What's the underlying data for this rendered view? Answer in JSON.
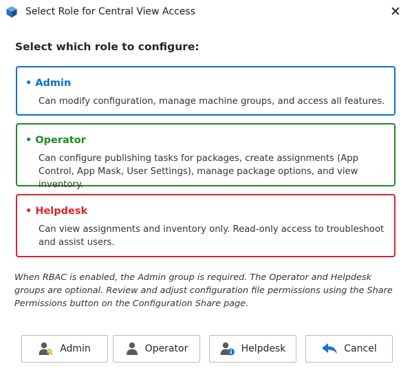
{
  "window": {
    "title": "Select Role for Central View Access",
    "close_label": "✕"
  },
  "heading": "Select which role to configure:",
  "roles": [
    {
      "title": "• Admin",
      "description": "Can modify configuration, manage machine groups, and access all features.",
      "color": "#0a6fd0"
    },
    {
      "title": "• Operator",
      "description": "Can configure publishing tasks for packages, create assignments (App Control, App Mask, User Settings), manage package options, and view inventory.",
      "color": "#1f8a1f"
    },
    {
      "title": "• Helpdesk",
      "description": "Can view assignments and inventory only. Read-only access to troubleshoot and assist users.",
      "color": "#d9232a"
    }
  ],
  "note": "When RBAC is enabled, the Admin group is required. The Operator and Helpdesk groups are optional. Review and adjust configuration file permissions using the Share Permissions button on the Configuration Share page.",
  "buttons": {
    "admin": "Admin",
    "operator": "Operator",
    "helpdesk": "Helpdesk",
    "cancel": "Cancel"
  },
  "icons": {
    "app": "cube-icon",
    "admin": "user-key-icon",
    "operator": "user-icon",
    "helpdesk": "user-info-icon",
    "cancel": "undo-arrow-icon"
  }
}
